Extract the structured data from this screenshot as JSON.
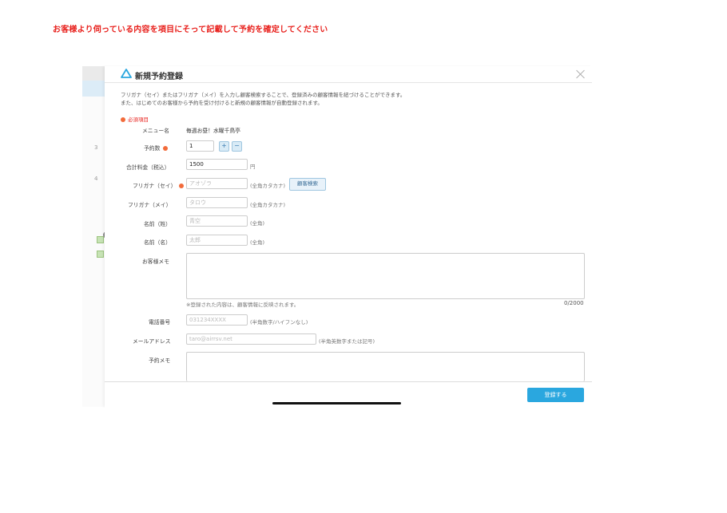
{
  "instruction": "お客様より伺っている内容を項目にそって記載して予約を確定してください",
  "background": {
    "row_numbers": [
      "3",
      "4"
    ]
  },
  "modal": {
    "title": "新規予約登録",
    "description_line1": "フリガナ（セイ）またはフリガナ（メイ）を入力し顧客検索することで、登録済みの顧客情報を紐づけることができます。",
    "description_line2": "また、はじめてのお客様から予約を受け付けると新規の顧客情報が自動登録されます。",
    "required_legend": "必須項目",
    "accent_color": "#2aa7df",
    "required_color": "#f26b3a",
    "fields": {
      "menu": {
        "label": "メニュー名",
        "value": "毎週お昼！水曜千鳥亭"
      },
      "count": {
        "label": "予約数",
        "value": "1",
        "plus": "+",
        "minus": "−"
      },
      "price": {
        "label": "合計料金（税込）",
        "value": "1500",
        "unit": "円"
      },
      "kana_sei": {
        "label": "フリガナ（セイ）",
        "placeholder": "アオゾラ",
        "hint": "(全角カタカナ)",
        "search_button": "顧客検索"
      },
      "kana_mei": {
        "label": "フリガナ（メイ）",
        "placeholder": "タロウ",
        "hint": "(全角カタカナ)"
      },
      "last_name": {
        "label": "名前（姓）",
        "placeholder": "青空",
        "hint": "(全角)"
      },
      "first_name": {
        "label": "名前（名）",
        "placeholder": "太郎",
        "hint": "(全角)"
      },
      "customer_memo": {
        "label": "お客様メモ",
        "note": "※登録された内容は、顧客情報に反映されます。",
        "counter": "0/2000"
      },
      "phone": {
        "label": "電話番号",
        "placeholder": "031234XXXX",
        "hint": "(半角数字/ハイフンなし)"
      },
      "email": {
        "label": "メールアドレス",
        "placeholder": "taro@airrsv.net",
        "hint": "(半角英数字または記号)"
      },
      "reservation_memo": {
        "label": "予約メモ"
      }
    },
    "submit_label": "登録する"
  }
}
